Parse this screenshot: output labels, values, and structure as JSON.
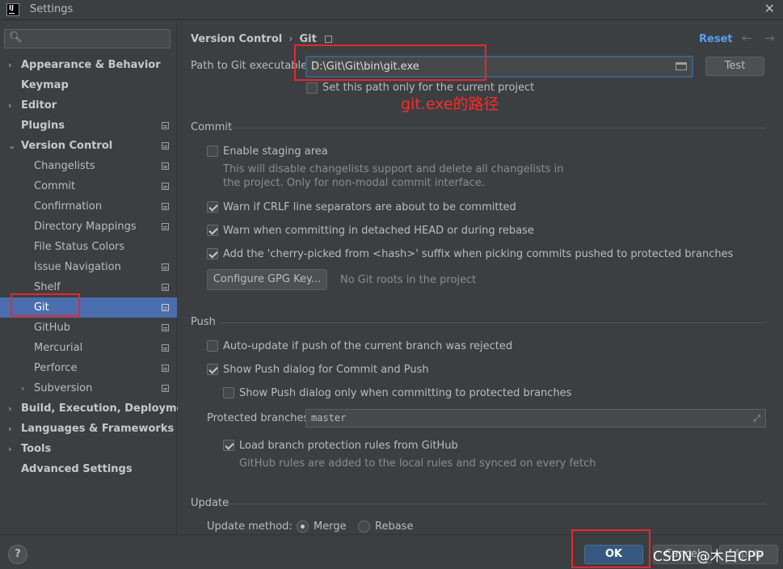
{
  "window": {
    "title": "Settings",
    "close_glyph": "✕"
  },
  "sidebar": {
    "search_placeholder": "",
    "items": [
      {
        "label": "Appearance & Behavior",
        "bold": true,
        "arrow": "›",
        "indent": 0,
        "icon": false
      },
      {
        "label": "Keymap",
        "bold": true,
        "arrow": "",
        "indent": 0,
        "icon": false
      },
      {
        "label": "Editor",
        "bold": true,
        "arrow": "›",
        "indent": 0,
        "icon": false
      },
      {
        "label": "Plugins",
        "bold": true,
        "arrow": "",
        "indent": 0,
        "icon": true
      },
      {
        "label": "Version Control",
        "bold": true,
        "arrow": "⌄",
        "indent": 0,
        "icon": true
      },
      {
        "label": "Changelists",
        "bold": false,
        "arrow": "",
        "indent": 1,
        "icon": true
      },
      {
        "label": "Commit",
        "bold": false,
        "arrow": "",
        "indent": 1,
        "icon": true
      },
      {
        "label": "Confirmation",
        "bold": false,
        "arrow": "",
        "indent": 1,
        "icon": true
      },
      {
        "label": "Directory Mappings",
        "bold": false,
        "arrow": "",
        "indent": 1,
        "icon": true
      },
      {
        "label": "File Status Colors",
        "bold": false,
        "arrow": "",
        "indent": 1,
        "icon": false
      },
      {
        "label": "Issue Navigation",
        "bold": false,
        "arrow": "",
        "indent": 1,
        "icon": true
      },
      {
        "label": "Shelf",
        "bold": false,
        "arrow": "",
        "indent": 1,
        "icon": true
      },
      {
        "label": "Git",
        "bold": false,
        "arrow": "",
        "indent": 1,
        "icon": true,
        "selected": true
      },
      {
        "label": "GitHub",
        "bold": false,
        "arrow": "",
        "indent": 1,
        "icon": true
      },
      {
        "label": "Mercurial",
        "bold": false,
        "arrow": "",
        "indent": 1,
        "icon": true
      },
      {
        "label": "Perforce",
        "bold": false,
        "arrow": "",
        "indent": 1,
        "icon": true
      },
      {
        "label": "Subversion",
        "bold": false,
        "arrow": "›",
        "indent": 1,
        "icon": true
      },
      {
        "label": "Build, Execution, Deployment",
        "bold": true,
        "arrow": "›",
        "indent": 0,
        "icon": false
      },
      {
        "label": "Languages & Frameworks",
        "bold": true,
        "arrow": "›",
        "indent": 0,
        "icon": false
      },
      {
        "label": "Tools",
        "bold": true,
        "arrow": "›",
        "indent": 0,
        "icon": false
      },
      {
        "label": "Advanced Settings",
        "bold": true,
        "arrow": "",
        "indent": 0,
        "icon": false
      }
    ]
  },
  "header": {
    "crumb_parent": "Version Control",
    "crumb_sep": "›",
    "crumb_current": "Git",
    "reset_label": "Reset",
    "back_glyph": "←",
    "forward_glyph": "→"
  },
  "git_path": {
    "label": "Path to Git executable:",
    "value": "D:\\Git\\Git\\bin\\git.exe",
    "test_label": "Test",
    "current_project_label": "Set this path only for the current project",
    "current_project_checked": false
  },
  "commit": {
    "title": "Commit",
    "staging_label": "Enable staging area",
    "staging_checked": false,
    "staging_hint_1": "This will disable changelists support and delete all changelists in",
    "staging_hint_2": "the project. Only for non-modal commit interface.",
    "crlf_label": "Warn if CRLF line separators are about to be committed",
    "crlf_checked": true,
    "detached_label": "Warn when committing in detached HEAD or during rebase",
    "detached_checked": true,
    "cherry_label": "Add the 'cherry-picked from <hash>' suffix when picking commits pushed to protected branches",
    "cherry_checked": true,
    "gpg_button": "Configure GPG Key...",
    "gpg_hint": "No Git roots in the project"
  },
  "push": {
    "title": "Push",
    "auto_update_label": "Auto-update if push of the current branch was rejected",
    "auto_update_checked": false,
    "show_dialog_label": "Show Push dialog for Commit and Push",
    "show_dialog_checked": true,
    "protected_only_label": "Show Push dialog only when committing to protected branches",
    "protected_only_checked": false,
    "protected_branches_label": "Protected branches:",
    "protected_branches_value": "master",
    "load_rules_label": "Load branch protection rules from GitHub",
    "load_rules_checked": true,
    "load_rules_hint": "GitHub rules are added to the local rules and synced on every fetch"
  },
  "update": {
    "title": "Update",
    "method_label": "Update method:",
    "merge_label": "Merge",
    "rebase_label": "Rebase",
    "selected": "Merge"
  },
  "footer": {
    "help_label": "?",
    "ok_label": "OK",
    "cancel_label": "Cancel",
    "apply_label": "Apply"
  },
  "annotations": {
    "git_exe_note": "git.exe的路径",
    "watermark": "CSDN @木白CPP"
  },
  "colors": {
    "background": "#3c3f41",
    "selection": "#4b6eaf",
    "link": "#589df6",
    "primary_button": "#365880",
    "annotation_red": "#e8262c"
  }
}
